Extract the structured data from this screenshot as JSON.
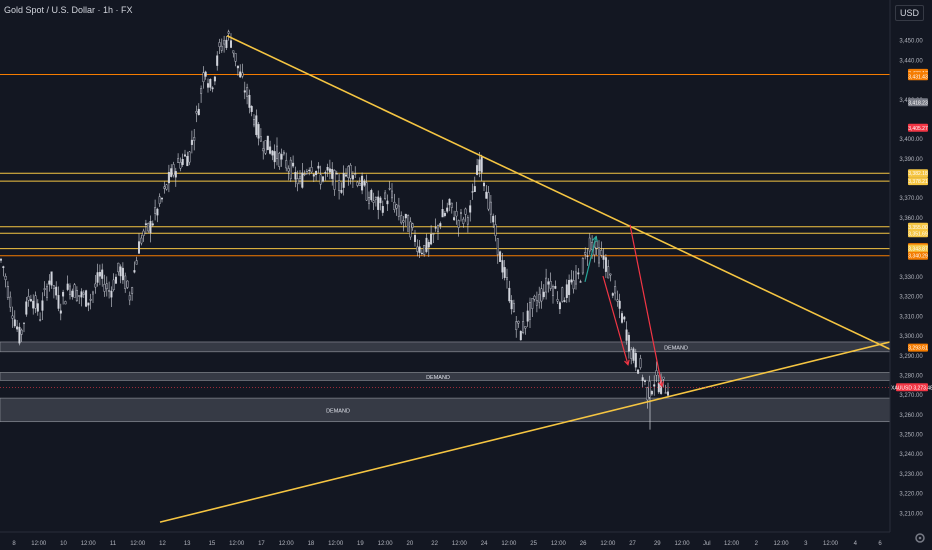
{
  "header": {
    "title": "Gold Spot / U.S. Dollar · 1h · FX",
    "currency": "USD"
  },
  "colors": {
    "background": "#131722",
    "up": "#d1d4dc",
    "down": "#1f2230",
    "resistance": "#f5c542",
    "orange_line": "#f57c00",
    "demand_zone": "#9598a1",
    "arrow": "#f23645",
    "arrow_green": "#26a69a"
  },
  "chart_data": {
    "type": "candlestick",
    "symbol": "Gold Spot / U.S. Dollar",
    "interval": "1h",
    "ylim": [
      3200,
      3460
    ],
    "y_ticks": [
      "3,450.00",
      "3,440.00",
      "3,420.00",
      "3,400.00",
      "3,390.00",
      "3,370.00",
      "3,360.00",
      "3,330.00",
      "3,320.00",
      "3,310.00",
      "3,300.00",
      "3,290.00",
      "3,280.00",
      "3,270.00",
      "3,260.00",
      "3,250.00",
      "3,240.00",
      "3,230.00",
      "3,220.00",
      "3,210.00"
    ],
    "x_ticks": [
      "8",
      "12:00",
      "10",
      "12:00",
      "11",
      "12:00",
      "12",
      "13",
      "15",
      "12:00",
      "17",
      "12:00",
      "18",
      "12:00",
      "19",
      "12:00",
      "20",
      "22",
      "12:00",
      "24",
      "12:00",
      "25",
      "12:00",
      "26",
      "12:00",
      "27",
      "29",
      "12:00",
      "Jul",
      "12:00",
      "2",
      "12:00",
      "3",
      "12:00",
      "4",
      "6"
    ],
    "price_tags": [
      {
        "label": "3,433.17",
        "value": 3433.17,
        "color": "#f57c00"
      },
      {
        "label": "3,431.43",
        "value": 3431.43,
        "color": "#f57c00"
      },
      {
        "label": "3,418.23",
        "value": 3418.23,
        "color": "#787b86"
      },
      {
        "label": "3,405.27",
        "value": 3405.27,
        "color": "#f23645"
      },
      {
        "label": "3,382.18",
        "value": 3382.18,
        "color": "#f5c542"
      },
      {
        "label": "3,378.21",
        "value": 3378.21,
        "color": "#f5c542"
      },
      {
        "label": "3,355.00",
        "value": 3355.0,
        "color": "#f5c542"
      },
      {
        "label": "3,351.69",
        "value": 3351.69,
        "color": "#f5c542"
      },
      {
        "label": "3,344.64",
        "value": 3344.64,
        "color": "#f57c00"
      },
      {
        "label": "3,343.87",
        "value": 3343.87,
        "color": "#f5c542"
      },
      {
        "label": "3,340.29",
        "value": 3340.29,
        "color": "#f57c00"
      },
      {
        "label": "3,293.61",
        "value": 3293.61,
        "color": "#f57c00"
      },
      {
        "label": "XAUUSD 3,273.48",
        "value": 3273.48,
        "color": "#f23645"
      }
    ],
    "horizontal_levels": [
      {
        "value": 3432.3,
        "color": "#f57c00"
      },
      {
        "value": 3382.18,
        "color": "#f5c542"
      },
      {
        "value": 3378.21,
        "color": "#f5c542"
      },
      {
        "value": 3355.0,
        "color": "#f5c542"
      },
      {
        "value": 3351.69,
        "color": "#f5c542"
      },
      {
        "value": 3343.87,
        "color": "#f5c542"
      },
      {
        "value": 3340.29,
        "color": "#f57c00"
      }
    ],
    "zones": [
      {
        "label": "DEMAND",
        "top": 3296.5,
        "bottom": 3291.5
      },
      {
        "label": "DEMAND",
        "top": 3281.0,
        "bottom": 3277.0
      },
      {
        "label": "DEMAND",
        "top": 3268.0,
        "bottom": 3256.0
      }
    ],
    "trendlines": [
      {
        "from": [
          227,
          3452
        ],
        "to": [
          910,
          3288
        ]
      },
      {
        "from": [
          160,
          3205
        ],
        "to": [
          910,
          3299
        ]
      }
    ],
    "annotations": [
      {
        "type": "arrow",
        "color": "#f23645",
        "from": [
          630,
          3356
        ],
        "to": [
          662,
          3274
        ]
      },
      {
        "type": "arrow",
        "color": "#f23645",
        "from": [
          603,
          3330
        ],
        "to": [
          628,
          3285
        ]
      },
      {
        "type": "arrow",
        "color": "#26a69a",
        "from": [
          585,
          3327
        ],
        "to": [
          596,
          3350
        ]
      }
    ],
    "path_points": [
      [
        2,
        3338
      ],
      [
        10,
        3318
      ],
      [
        20,
        3298
      ],
      [
        30,
        3322
      ],
      [
        40,
        3310
      ],
      [
        50,
        3330
      ],
      [
        60,
        3315
      ],
      [
        70,
        3325
      ],
      [
        80,
        3320
      ],
      [
        90,
        3318
      ],
      [
        100,
        3330
      ],
      [
        110,
        3322
      ],
      [
        120,
        3334
      ],
      [
        130,
        3320
      ],
      [
        140,
        3348
      ],
      [
        150,
        3355
      ],
      [
        160,
        3366
      ],
      [
        170,
        3380
      ],
      [
        180,
        3388
      ],
      [
        190,
        3392
      ],
      [
        200,
        3420
      ],
      [
        205,
        3438
      ],
      [
        210,
        3425
      ],
      [
        215,
        3433
      ],
      [
        220,
        3446
      ],
      [
        230,
        3452
      ],
      [
        240,
        3432
      ],
      [
        250,
        3418
      ],
      [
        260,
        3400
      ],
      [
        270,
        3395
      ],
      [
        280,
        3390
      ],
      [
        290,
        3385
      ],
      [
        300,
        3377
      ],
      [
        310,
        3388
      ],
      [
        320,
        3380
      ],
      [
        330,
        3382
      ],
      [
        340,
        3375
      ],
      [
        350,
        3385
      ],
      [
        360,
        3378
      ],
      [
        370,
        3370
      ],
      [
        380,
        3365
      ],
      [
        390,
        3372
      ],
      [
        400,
        3360
      ],
      [
        410,
        3355
      ],
      [
        420,
        3344
      ],
      [
        430,
        3345
      ],
      [
        440,
        3358
      ],
      [
        450,
        3365
      ],
      [
        460,
        3358
      ],
      [
        470,
        3362
      ],
      [
        480,
        3390
      ],
      [
        490,
        3365
      ],
      [
        500,
        3340
      ],
      [
        510,
        3320
      ],
      [
        520,
        3300
      ],
      [
        530,
        3312
      ],
      [
        540,
        3320
      ],
      [
        550,
        3328
      ],
      [
        560,
        3318
      ],
      [
        570,
        3324
      ],
      [
        580,
        3330
      ],
      [
        590,
        3348
      ],
      [
        598,
        3342
      ],
      [
        605,
        3338
      ],
      [
        615,
        3320
      ],
      [
        625,
        3305
      ],
      [
        632,
        3290
      ],
      [
        640,
        3284
      ],
      [
        648,
        3270
      ],
      [
        655,
        3278
      ],
      [
        662,
        3274
      ]
    ],
    "last_price": 3273.48,
    "title": "",
    "xlabel": "",
    "ylabel": ""
  }
}
